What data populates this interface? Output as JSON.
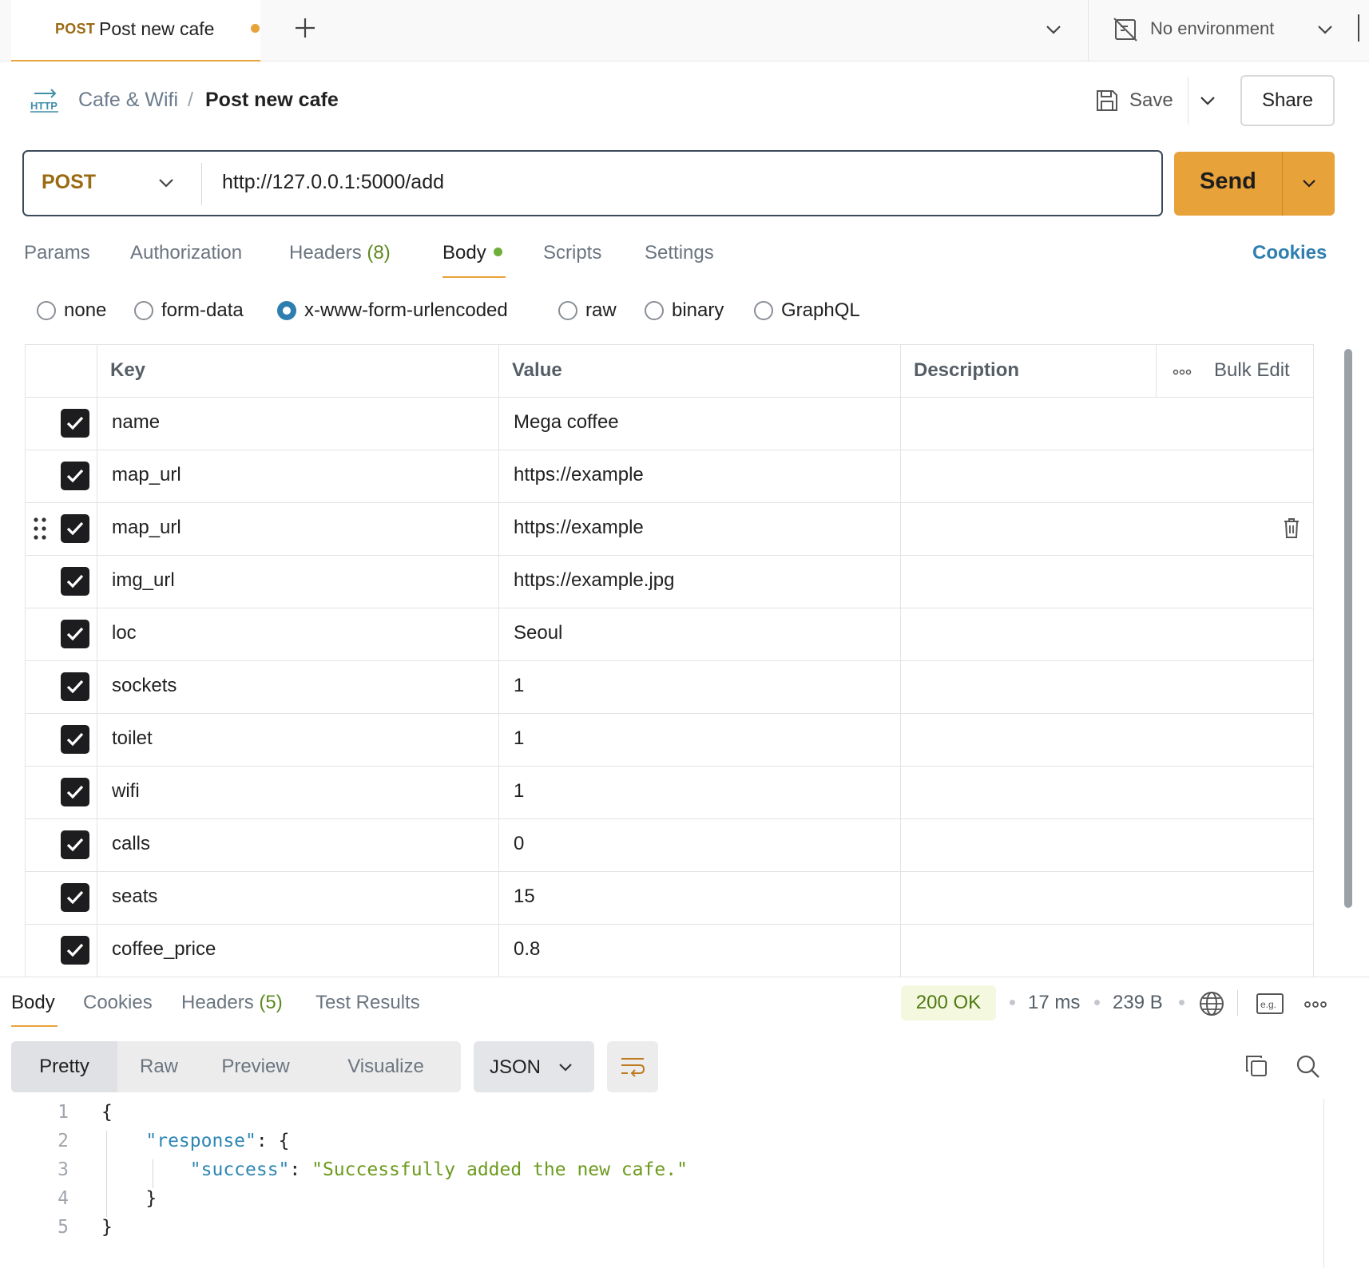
{
  "tab": {
    "method": "POST",
    "title": "Post new cafe"
  },
  "environment": {
    "label": "No environment"
  },
  "breadcrumb": {
    "parent": "Cafe & Wifi",
    "separator": "/",
    "current": "Post new cafe"
  },
  "toolbar": {
    "save_label": "Save",
    "share_label": "Share"
  },
  "request": {
    "method": "POST",
    "url": "http://127.0.0.1:5000/add",
    "send_label": "Send"
  },
  "request_tabs": [
    {
      "label": "Params"
    },
    {
      "label": "Authorization"
    },
    {
      "label": "Headers",
      "count": "(8)"
    },
    {
      "label": "Body"
    },
    {
      "label": "Scripts"
    },
    {
      "label": "Settings"
    }
  ],
  "cookies_label": "Cookies",
  "body_types": [
    {
      "label": "none",
      "selected": false
    },
    {
      "label": "form-data",
      "selected": false
    },
    {
      "label": "x-www-form-urlencoded",
      "selected": true
    },
    {
      "label": "raw",
      "selected": false
    },
    {
      "label": "binary",
      "selected": false
    },
    {
      "label": "GraphQL",
      "selected": false
    }
  ],
  "table": {
    "headers": {
      "key": "Key",
      "value": "Value",
      "description": "Description",
      "bulk_edit": "Bulk Edit"
    },
    "rows": [
      {
        "key": "name",
        "value": "Mega coffee",
        "checked": true
      },
      {
        "key": "map_url",
        "value": "https://example",
        "checked": true
      },
      {
        "key": "map_url",
        "value": "https://example",
        "checked": true
      },
      {
        "key": "img_url",
        "value": "https://example.jpg",
        "checked": true
      },
      {
        "key": "loc",
        "value": "Seoul",
        "checked": true
      },
      {
        "key": "sockets",
        "value": "1",
        "checked": true
      },
      {
        "key": "toilet",
        "value": "1",
        "checked": true
      },
      {
        "key": "wifi",
        "value": "1",
        "checked": true
      },
      {
        "key": "calls",
        "value": "0",
        "checked": true
      },
      {
        "key": "seats",
        "value": "15",
        "checked": true
      },
      {
        "key": "coffee_price",
        "value": "0.8",
        "checked": true
      }
    ]
  },
  "response": {
    "tabs": [
      {
        "label": "Body"
      },
      {
        "label": "Cookies"
      },
      {
        "label": "Headers",
        "count": "(5)"
      },
      {
        "label": "Test Results"
      }
    ],
    "status": "200 OK",
    "time": "17 ms",
    "size": "239 B",
    "view_modes": [
      "Pretty",
      "Raw",
      "Preview",
      "Visualize"
    ],
    "format": "JSON",
    "code": {
      "line_numbers": [
        "1",
        "2",
        "3",
        "4",
        "5"
      ],
      "open_brace": "{",
      "response_key": "\"response\"",
      "colon": ": ",
      "inner_open": "{",
      "success_key": "\"success\"",
      "success_value": "\"Successfully added the new cafe.\"",
      "inner_close": "}",
      "close_brace": "}"
    }
  },
  "colors": {
    "accent": "#e8a23a",
    "method": "#9a6b12",
    "link": "#2e7fb0",
    "status_ok": "#4f7a14"
  }
}
